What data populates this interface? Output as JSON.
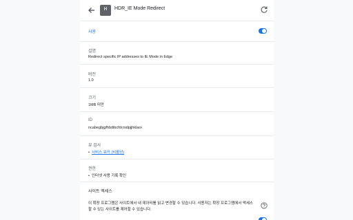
{
  "header": {
    "title": "HDR_IE Mode Redirect",
    "icon_letter": "H"
  },
  "enabled": {
    "label": "사용",
    "state": true
  },
  "description": {
    "label": "설명",
    "text": "Redirect specific IP addresses to IE Mode in Edge"
  },
  "version": {
    "label": "버전",
    "value": "1.0"
  },
  "size": {
    "label": "크기",
    "value": "1MB 미만"
  },
  "id": {
    "label": "ID",
    "value": "ncabegbjgfhbdibcfdcnidpjjhklaoi"
  },
  "inspect": {
    "label": "뷰 검사",
    "link": "서비스 워커 (비활성)"
  },
  "permissions": {
    "label": "권한",
    "item": "인터넷 사용 기록 확인"
  },
  "site_access": {
    "label": "사이트 액세스",
    "text_line1": "이 확장 프로그램은 사이트에서 내 데이터를 읽고 변경할 수 있습니다. 사용자는 확장 프로그램에서 액세스",
    "text_line2": "할 수 있는 사이트를 제어할 수 있습니다."
  },
  "colors": {
    "accent": "#1a73e8",
    "divider": "#e8eaed"
  }
}
